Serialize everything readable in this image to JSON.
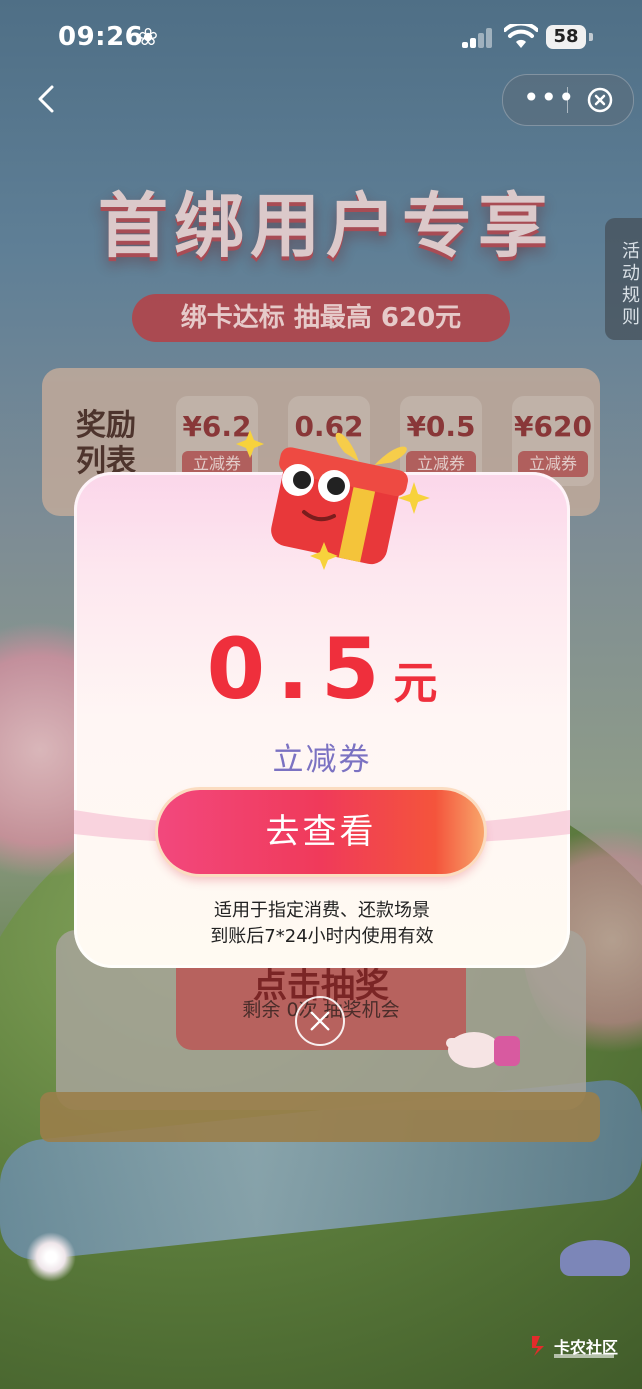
{
  "status_bar": {
    "time": "09:26",
    "battery": "58"
  },
  "banner": {
    "title": "首绑用户专享",
    "subtitle": "绑卡达标 抽最高 620元",
    "rules_tab": "活动规则"
  },
  "reward_list": {
    "label": "奖励列表",
    "items": [
      {
        "amount": "¥6.2",
        "tag": "立减券"
      },
      {
        "amount": "0.62",
        "tag": ""
      },
      {
        "amount": "¥0.5",
        "tag": "立减券"
      },
      {
        "amount": "¥620",
        "tag": "立减券"
      }
    ]
  },
  "draw": {
    "label": "点击抽奖",
    "remaining": "剩余 0次 抽奖机会"
  },
  "modal": {
    "amount": "0.5",
    "unit": "元",
    "coupon_type": "立减券",
    "button_label": "去查看",
    "note_line1": "适用于指定消费、还款场景",
    "note_line2": "到账后7*24小时内使用有效"
  },
  "watermark": {
    "text": "卡农社区"
  },
  "colors": {
    "accent_red": "#ef2f3c",
    "coupon_purple": "#7b72c2",
    "button_pink": "#f03a5a"
  }
}
